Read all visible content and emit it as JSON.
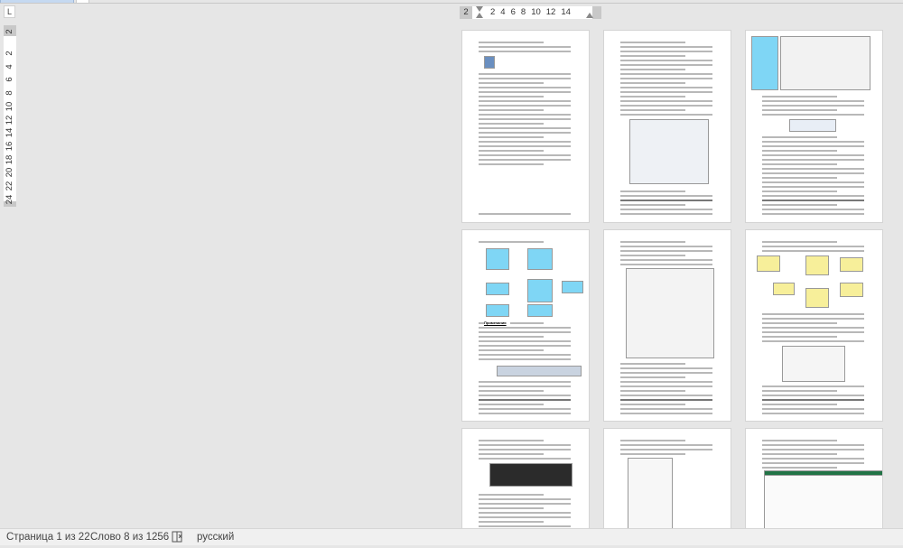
{
  "ruler": {
    "corner_label": "L",
    "horizontal_first": "2",
    "horizontal_ticks": [
      "2",
      "4",
      "6",
      "8",
      "10",
      "12",
      "14"
    ],
    "vertical_first": "2",
    "vertical_ticks": [
      "2",
      "4",
      "6",
      "8",
      "10",
      "12",
      "14",
      "16",
      "18",
      "20",
      "22",
      "24"
    ]
  },
  "document": {
    "page_count_visible": 9,
    "pages": [
      {
        "figure": "title-page"
      },
      {
        "figure": "sql-developer-dialog"
      },
      {
        "figure": "data-modeler-window"
      },
      {
        "figure": "er-diagram",
        "heading": "Примечания"
      },
      {
        "figure": "data-modeler-browser"
      },
      {
        "figure": "relational-diagram"
      },
      {
        "figure": "terminal"
      },
      {
        "figure": "tree-view"
      },
      {
        "figure": "excel-sheet"
      }
    ]
  },
  "status_bar": {
    "page": "Страница 1 из 22",
    "words": "Слово 8 из 1256",
    "proofing_icon": "book-x-icon",
    "language": "русский"
  },
  "colors": {
    "accent": "#c5d9f1",
    "erd_table": "#7fd6f5",
    "excel_green": "#217346"
  }
}
